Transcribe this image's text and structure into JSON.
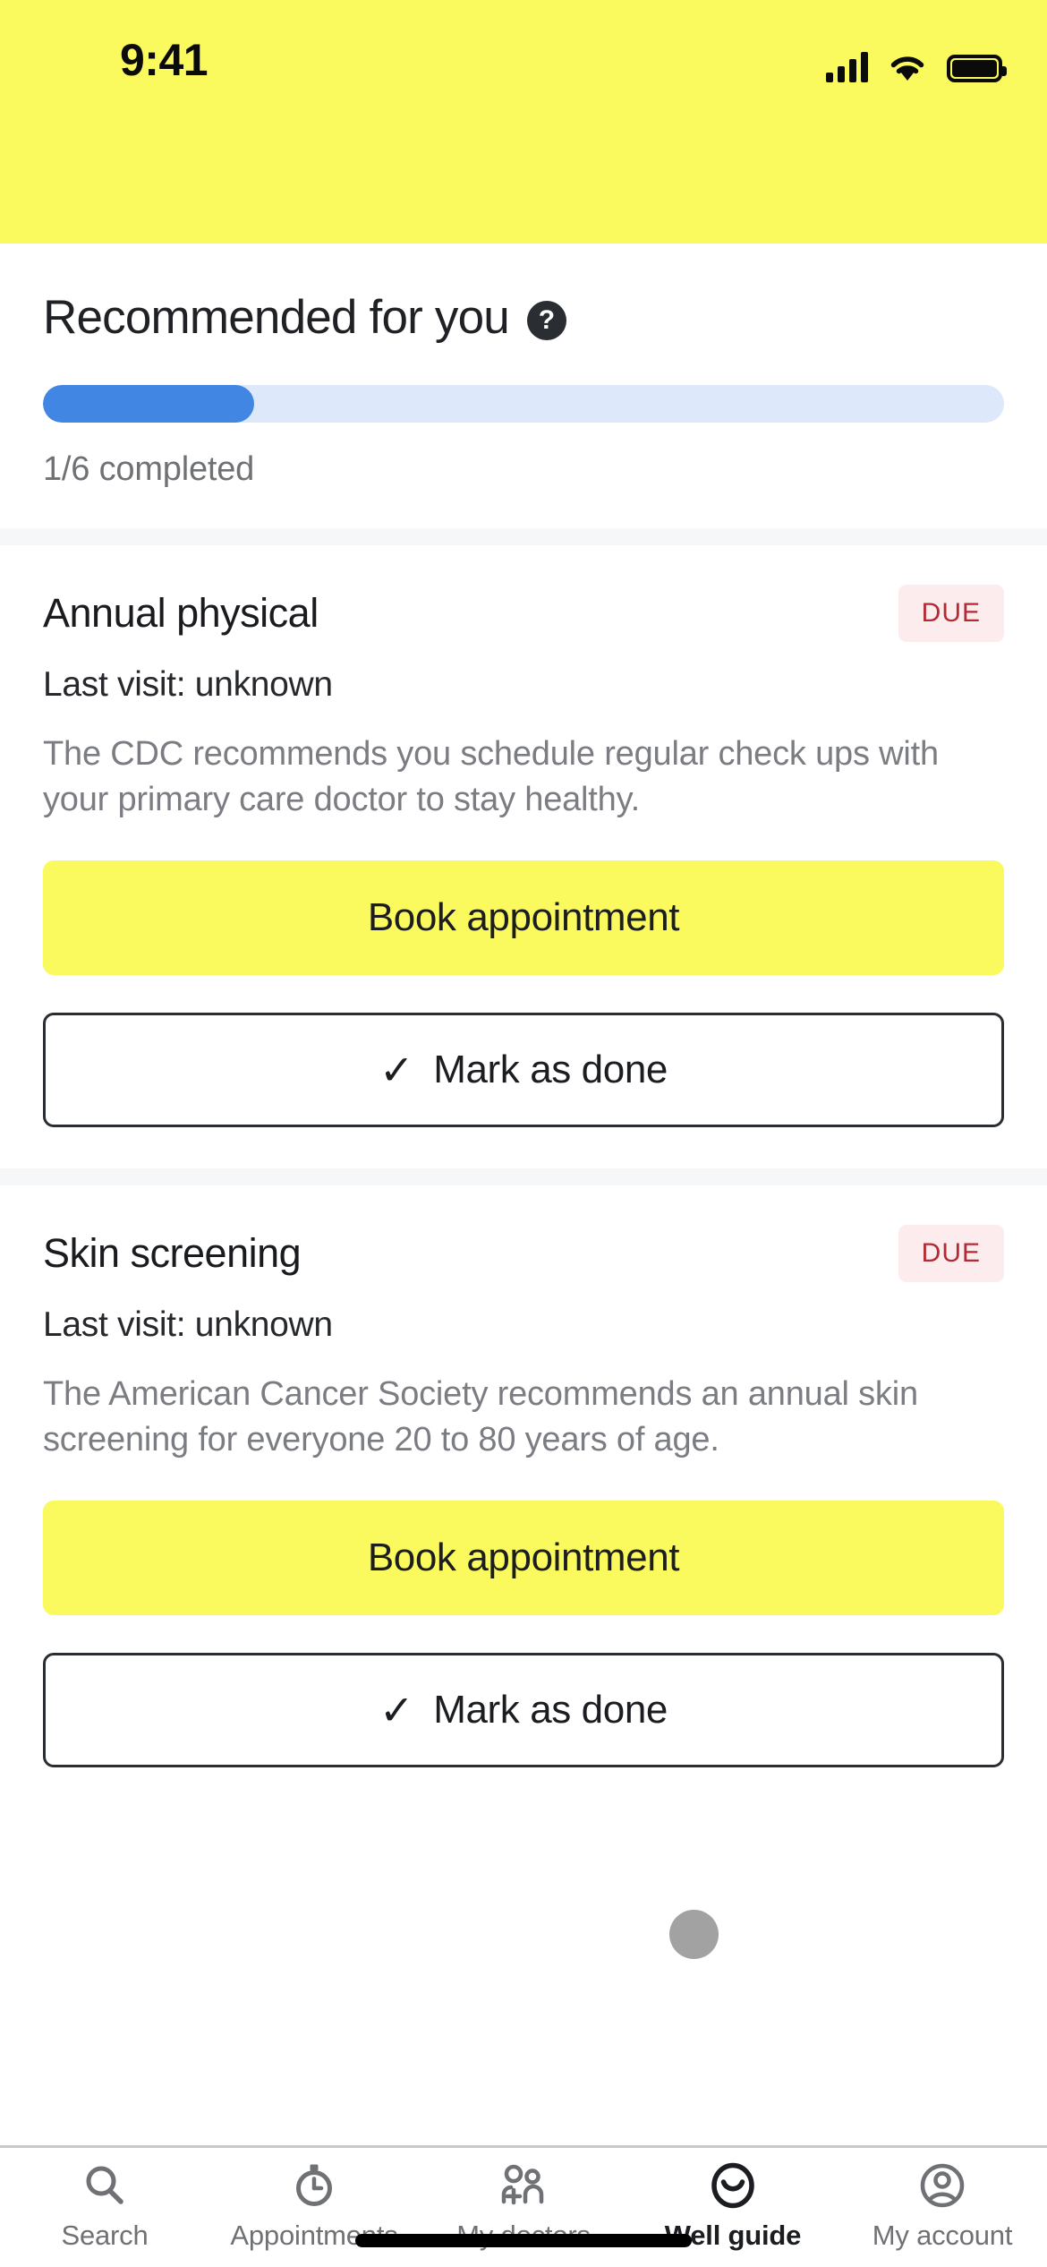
{
  "status_bar": {
    "time": "9:41",
    "background": "#FAF95E",
    "icons": [
      "cellular-signal-icon",
      "wifi-icon",
      "battery-icon"
    ]
  },
  "header": {
    "title": "Recommended for you",
    "help_icon": "help-circle-icon",
    "help_glyph": "?",
    "progress": {
      "percent": 22,
      "label": "1/6 completed",
      "fill_color": "#4286e4",
      "track_color": "#dde8fa"
    }
  },
  "recommendations": [
    {
      "title": "Annual physical",
      "badge": "DUE",
      "badge_color": "#b32a32",
      "badge_bg": "#fdecee",
      "last_visit": "Last visit: unknown",
      "description": "The CDC recommends you schedule regular check ups with your primary care doctor to stay healthy.",
      "primary_button": "Book appointment",
      "secondary_button": "Mark as done",
      "check_glyph": "✓"
    },
    {
      "title": "Skin screening",
      "badge": "DUE",
      "badge_color": "#b32a32",
      "badge_bg": "#fdecee",
      "last_visit": "Last visit: unknown",
      "description": "The American Cancer Society recommends an annual skin screening for everyone 20 to 80 years of age.",
      "primary_button": "Book appointment",
      "secondary_button": "Mark as done",
      "check_glyph": "✓"
    }
  ],
  "bottom_nav": {
    "items": [
      {
        "label": "Search",
        "icon": "search-icon",
        "active": false
      },
      {
        "label": "Appointments",
        "icon": "clock-icon",
        "active": false
      },
      {
        "label": "My doctors",
        "icon": "people-add-icon",
        "active": false
      },
      {
        "label": "Well guide",
        "icon": "smiley-face-icon",
        "active": true
      },
      {
        "label": "My account",
        "icon": "account-circle-icon",
        "active": false
      }
    ]
  },
  "theme": {
    "brand_yellow": "#FAF95E",
    "text_dark": "#1b1d21",
    "text_muted": "#6f7175",
    "divider": "#f6f7f8"
  }
}
